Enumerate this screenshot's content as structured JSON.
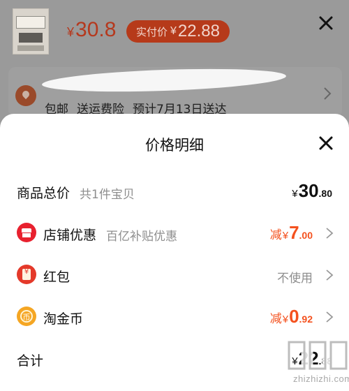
{
  "background": {
    "price": {
      "currency": "¥",
      "amount": "30.8"
    },
    "pay_pill": {
      "label": "实付价",
      "currency": "¥",
      "amount": "22.88"
    },
    "shipping_info": [
      "包邮",
      "送运费险",
      "预计7月13日送达"
    ]
  },
  "sheet": {
    "title": "价格明细",
    "rows": [
      {
        "label": "商品总价",
        "sub": "共1件宝贝",
        "prefix": "",
        "currency": "¥",
        "int": "30",
        "dec": ".80"
      },
      {
        "label": "店铺优惠",
        "sub": "百亿补贴优惠",
        "prefix": "减",
        "currency": "¥",
        "int": "7",
        "dec": ".00"
      },
      {
        "label": "红包",
        "value": "不使用"
      },
      {
        "label": "淘金币",
        "prefix": "减",
        "currency": "¥",
        "int": "0",
        "dec": ".92"
      },
      {
        "label": "合计",
        "currency": "¥",
        "int": "22",
        "dec": ".88"
      }
    ]
  },
  "icons": {
    "shop": {
      "glyph": "",
      "color": "#e8212f"
    },
    "red_packet": {
      "glyph": "¥",
      "color": "#e4392a"
    },
    "coin": {
      "glyph": "币",
      "color": "#f5a623"
    }
  },
  "watermark": {
    "text": "zhizhizhi.com",
    "logo_text": "值值值"
  }
}
